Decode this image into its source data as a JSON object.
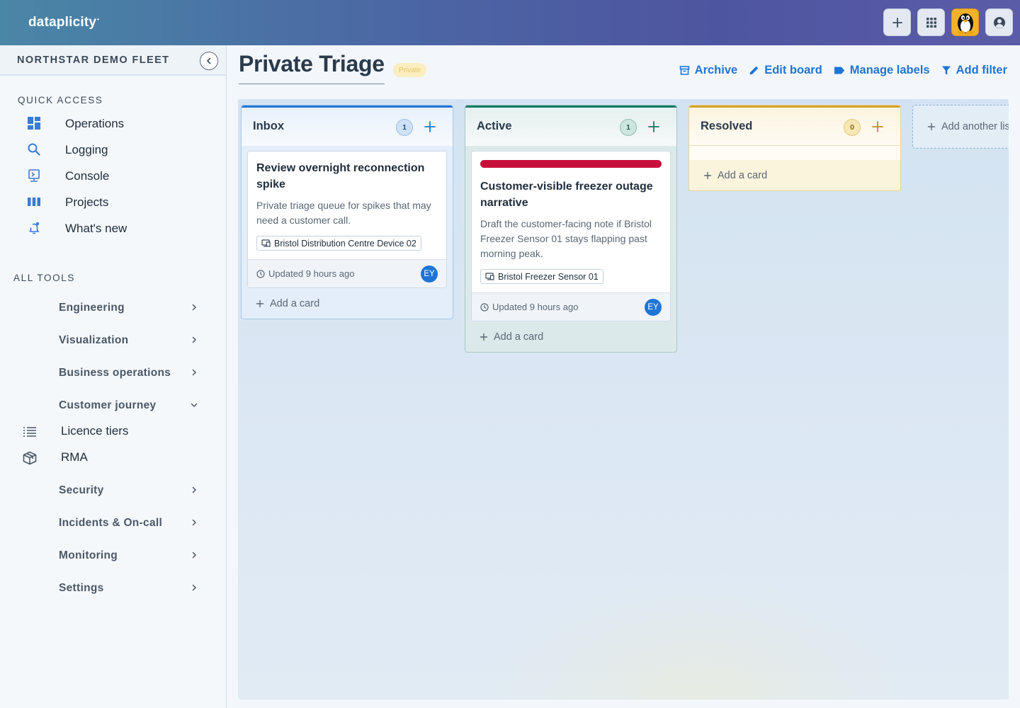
{
  "app": {
    "brand": "dataplicity",
    "brand_mark": "•"
  },
  "sidebar": {
    "fleet_name": "NORTHSTAR DEMO FLEET",
    "quick_access_heading": "QUICK ACCESS",
    "quick_access": [
      {
        "label": "Operations",
        "icon": "dashboard-icon"
      },
      {
        "label": "Logging",
        "icon": "search-icon"
      },
      {
        "label": "Console",
        "icon": "terminal-icon"
      },
      {
        "label": "Projects",
        "icon": "columns-icon"
      },
      {
        "label": "What's new",
        "icon": "bell-icon"
      }
    ],
    "all_tools_heading": "ALL TOOLS",
    "tools": [
      {
        "label": "Engineering"
      },
      {
        "label": "Visualization"
      },
      {
        "label": "Business operations"
      },
      {
        "label": "Customer journey"
      },
      {
        "label": "Security"
      },
      {
        "label": "Incidents & On-call"
      },
      {
        "label": "Monitoring"
      },
      {
        "label": "Settings"
      }
    ],
    "customer_journey_items": [
      {
        "label": "Licence tiers",
        "icon": "list-icon"
      },
      {
        "label": "RMA",
        "icon": "package-icon"
      }
    ]
  },
  "header": {
    "title": "Private Triage",
    "badge": "Private",
    "actions": {
      "archive": "Archive",
      "edit_board": "Edit board",
      "manage_labels": "Manage labels",
      "add_filter": "Add filter"
    }
  },
  "board": {
    "lists": [
      {
        "title": "Inbox",
        "count": "1",
        "accent": "#1f74d6",
        "cards": [
          {
            "title": "Review overnight reconnection spike",
            "description": "Private triage queue for spikes that may need a customer call.",
            "tag": "Bristol Distribution Centre Device 02",
            "updated": "Updated 9 hours ago",
            "avatar": "EY"
          }
        ],
        "add_card": "Add a card"
      },
      {
        "title": "Active",
        "count": "1",
        "accent": "#117a65",
        "cards": [
          {
            "label_color": "#c8103c",
            "title": "Customer-visible freezer outage narrative",
            "description": "Draft the customer-facing note if Bristol Freezer Sensor 01 stays flapping past morning peak.",
            "tag": "Bristol Freezer Sensor 01",
            "updated": "Updated 9 hours ago",
            "avatar": "EY"
          }
        ],
        "add_card": "Add a card"
      },
      {
        "title": "Resolved",
        "count": "0",
        "accent": "#d4a22a",
        "cards": [],
        "add_card": "Add a card"
      }
    ],
    "add_list": "Add another list"
  }
}
